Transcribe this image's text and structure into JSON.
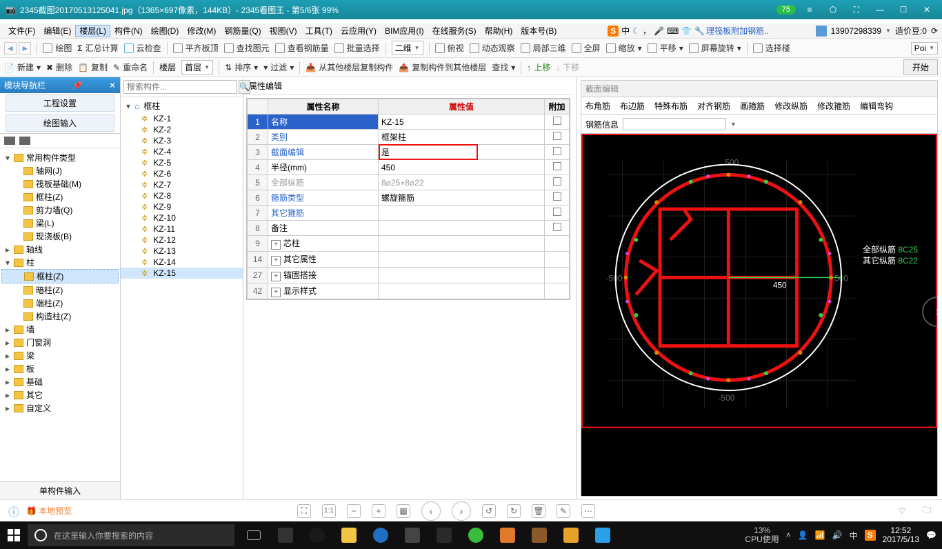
{
  "viewer": {
    "title": "2345截图20170513125041.jpg（1365×697像素，144KB）- 2345看图王 - 第5/6张 99%",
    "badge": "75",
    "footer_preview": "本地预览"
  },
  "menu": {
    "items": [
      "文件(F)",
      "编辑(E)",
      "楼层(L)",
      "构件(N)",
      "绘图(D)",
      "修改(M)",
      "钢筋量(Q)",
      "视图(V)",
      "工具(T)",
      "云应用(Y)",
      "BIM应用(I)",
      "在线服务(S)",
      "帮助(H)",
      "版本号(B)"
    ],
    "selected_index": 2,
    "ribbon_doc": "理筏板附加钢筋..",
    "account": "13907298339",
    "coins_label": "造价豆:0"
  },
  "toolbar1": {
    "draw": "绘图",
    "sumcalc": "汇总计算",
    "cloudcheck": "云检查",
    "balancetop": "平齐板顶",
    "findelem": "查找图元",
    "checkbar": "查看钢筋量",
    "batchsel": "批量选择",
    "viewmode": "二维",
    "overhead": "俯视",
    "dynview": "动态观察",
    "local3d": "局部三维",
    "fullscreen": "全屏",
    "zoom": "缩放",
    "pan": "平移",
    "screenspin": "屏幕旋转",
    "selfloor": "选择楼"
  },
  "toolbar2": {
    "new": "新建",
    "del": "删除",
    "copy": "复制",
    "rename": "重命名",
    "floorsel": "楼层",
    "floorval": "首层",
    "sort": "排序",
    "filter": "过滤",
    "copyfromother": "从其他楼层复制构件",
    "copytoother": "复制构件到其他楼层",
    "find": "查找",
    "moveup": "上移",
    "movedown": "下移",
    "start": "开始"
  },
  "leftdock": {
    "title": "模块导航栏",
    "btn_project": "工程设置",
    "btn_draw": "绘图输入",
    "tree": [
      {
        "lvl": 1,
        "tw": "▾",
        "label": "常用构件类型"
      },
      {
        "lvl": 2,
        "tw": "",
        "label": "轴网(J)"
      },
      {
        "lvl": 2,
        "tw": "",
        "label": "筏板基础(M)"
      },
      {
        "lvl": 2,
        "tw": "",
        "label": "框柱(Z)"
      },
      {
        "lvl": 2,
        "tw": "",
        "label": "剪力墙(Q)"
      },
      {
        "lvl": 2,
        "tw": "",
        "label": "梁(L)"
      },
      {
        "lvl": 2,
        "tw": "",
        "label": "现浇板(B)"
      },
      {
        "lvl": 1,
        "tw": "▸",
        "label": "轴线"
      },
      {
        "lvl": 1,
        "tw": "▾",
        "label": "柱"
      },
      {
        "lvl": 2,
        "tw": "",
        "label": "框柱(Z)",
        "sel": true
      },
      {
        "lvl": 2,
        "tw": "",
        "label": "暗柱(Z)"
      },
      {
        "lvl": 2,
        "tw": "",
        "label": "端柱(Z)"
      },
      {
        "lvl": 2,
        "tw": "",
        "label": "构造柱(Z)"
      },
      {
        "lvl": 1,
        "tw": "▸",
        "label": "墙"
      },
      {
        "lvl": 1,
        "tw": "▸",
        "label": "门窗洞"
      },
      {
        "lvl": 1,
        "tw": "▸",
        "label": "梁"
      },
      {
        "lvl": 1,
        "tw": "▸",
        "label": "板"
      },
      {
        "lvl": 1,
        "tw": "▸",
        "label": "基础"
      },
      {
        "lvl": 1,
        "tw": "▸",
        "label": "其它"
      },
      {
        "lvl": 1,
        "tw": "▸",
        "label": "自定义"
      }
    ],
    "footer": "单构件输入"
  },
  "search": {
    "placeholder": "搜索构件..."
  },
  "kzlist": {
    "group": "框柱",
    "items": [
      "KZ-1",
      "KZ-2",
      "KZ-3",
      "KZ-4",
      "KZ-5",
      "KZ-6",
      "KZ-7",
      "KZ-8",
      "KZ-9",
      "KZ-10",
      "KZ-11",
      "KZ-12",
      "KZ-13",
      "KZ-14",
      "KZ-15"
    ],
    "selected": "KZ-15"
  },
  "props": {
    "title": "属性编辑",
    "head_name": "属性名称",
    "head_value": "属性值",
    "head_add": "附加",
    "rows": [
      {
        "n": "1",
        "name": "名称",
        "val": "KZ-15",
        "link": true,
        "sel": true,
        "chk": false
      },
      {
        "n": "2",
        "name": "类别",
        "val": "框架柱",
        "link": true,
        "chk": true
      },
      {
        "n": "3",
        "name": "截面编辑",
        "val": "是",
        "link": true,
        "redbox": true,
        "chk": false
      },
      {
        "n": "4",
        "name": "半径(mm)",
        "val": "450",
        "chk": true
      },
      {
        "n": "5",
        "name": "全部纵筋",
        "val": "8⌀25+8⌀22",
        "grey": true,
        "chk": true
      },
      {
        "n": "6",
        "name": "箍筋类型",
        "val": "螺旋箍筋",
        "link": true,
        "chk": true
      },
      {
        "n": "7",
        "name": "其它箍筋",
        "val": "",
        "link": true,
        "chk": false
      },
      {
        "n": "8",
        "name": "备注",
        "val": "",
        "chk": true
      },
      {
        "n": "9",
        "name": "芯柱",
        "exp": true
      },
      {
        "n": "14",
        "name": "其它属性",
        "exp": true
      },
      {
        "n": "27",
        "name": "锚固搭接",
        "exp": true
      },
      {
        "n": "42",
        "name": "显示样式",
        "exp": true
      }
    ]
  },
  "section": {
    "title": "截面编辑",
    "tabs": [
      "布角筋",
      "布边筋",
      "特殊布筋",
      "对齐钢筋",
      "画箍筋",
      "修改纵筋",
      "修改箍筋",
      "编辑弯钩"
    ],
    "info_label": "钢筋信息",
    "radius_label": "450",
    "legend_all_label": "全部纵筋",
    "legend_all_val": "8C25",
    "legend_other_label": "其它纵筋",
    "legend_other_val": "8C22"
  },
  "taskbar": {
    "search_placeholder": "在这里输入你要搜索的内容",
    "cpu_pct": "13%",
    "cpu_label": "CPU使用",
    "time": "12:52",
    "date": "2017/5/13"
  }
}
